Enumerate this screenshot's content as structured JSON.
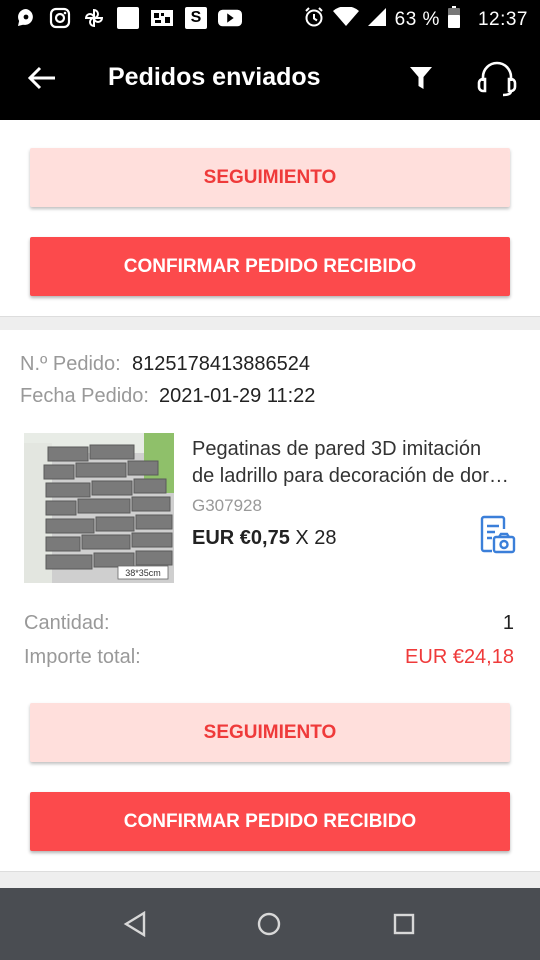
{
  "status_bar": {
    "battery_percent": "63 %",
    "time": "12:37"
  },
  "header": {
    "title": "Pedidos enviados",
    "icons": [
      "back-arrow-icon",
      "filter-icon",
      "headset-icon"
    ]
  },
  "prev_order": {
    "tracking_label": "SEGUIMIENTO",
    "confirm_label": "CONFIRMAR PEDIDO RECIBIDO"
  },
  "order": {
    "number_label": "N.º Pedido:",
    "number": "8125178413886524",
    "date_label": "Fecha Pedido:",
    "date": "2021-01-29 11:22",
    "product": {
      "title_line1": "Pegatinas de pared 3D imitación",
      "title_line2": "de ladrillo para decoración de dormitorio",
      "sku": "G307928",
      "price": "EUR €0,75",
      "quantity_text": "X 28",
      "image_caption": "38*35cm"
    },
    "quantity_label": "Cantidad:",
    "quantity": "1",
    "total_label": "Importe total:",
    "total": "EUR €24,18",
    "tracking_label": "SEGUIMIENTO",
    "confirm_label": "CONFIRMAR PEDIDO RECIBIDO"
  },
  "colors": {
    "accent_red": "#fc4a4c",
    "light_pink": "#ffdfdc",
    "total_red": "#ef3a3a"
  }
}
